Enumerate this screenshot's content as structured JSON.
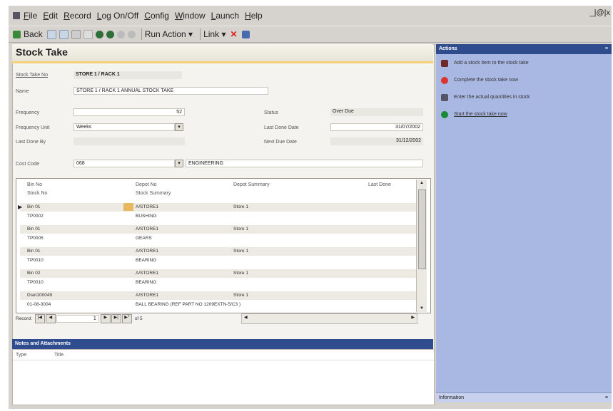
{
  "menu": [
    "File",
    "Edit",
    "Record",
    "Log On/Off",
    "Config",
    "Window",
    "Launch",
    "Help"
  ],
  "window_controls": "_|@|x",
  "toolbar": {
    "back": "Back",
    "run_action": "Run Action ▾",
    "link": "Link ▾"
  },
  "page_title": "Stock Take",
  "form": {
    "stock_take_no_label": "Stock Take No",
    "stock_take_no": "STORE 1 / RACK 1",
    "name_label": "Name",
    "name": "STORE 1 / RACK 1 ANNUAL STOCK TAKE",
    "frequency_label": "Frequency",
    "frequency": "52",
    "frequency_unit_label": "Frequency Unit",
    "frequency_unit": "Weeks",
    "last_done_by_label": "Last Done By",
    "last_done_by": "",
    "status_label": "Status",
    "status": "Over Due",
    "last_done_date_label": "Last Done Date",
    "last_done_date": "31/07/2002",
    "next_due_date_label": "Next Due Date",
    "next_due_date": "31/12/2002",
    "cost_code_label": "Cost Code",
    "cost_code": "068",
    "cost_code_desc": "ENGINEERING"
  },
  "grid": {
    "headers": {
      "bin_no": "Bin No",
      "stock_no": "Stock No",
      "depot_no": "Depot No",
      "stock_summary": "Stock Summary",
      "depot_summary": "Depot Summary",
      "last_done": "Last Done"
    },
    "rows": [
      {
        "bin": "Bin 01",
        "stock": "TP0002",
        "depot": "A/STORE1",
        "summary": "BUSHING",
        "depot_summary": "Store 1"
      },
      {
        "bin": "Bin 01",
        "stock": "TP0005",
        "depot": "A/STORE1",
        "summary": "GEARS",
        "depot_summary": "Store 1"
      },
      {
        "bin": "Bin 01",
        "stock": "TP0010",
        "depot": "A/STORE1",
        "summary": "BEARING",
        "depot_summary": "Store 1"
      },
      {
        "bin": "Bin 02",
        "stock": "TP0010",
        "depot": "A/STORE1",
        "summary": "BEARING",
        "depot_summary": "Store 1"
      },
      {
        "bin": "Dset100049",
        "stock": "01-08-3004",
        "depot": "A/STORE1",
        "summary": "BALL BEARING (REF PART NO 1209EXTN-5/C3 )",
        "depot_summary": "Store 1"
      }
    ],
    "record_label": "Record:",
    "record_value": "1",
    "of_label": "of 5"
  },
  "notes": {
    "title": "Notes and Attachments",
    "col_type": "Type",
    "col_title": "Title"
  },
  "actions": {
    "title": "Actions",
    "items": [
      "Add a stock item to the stock take",
      "Complete the stock take now",
      "Enter the actual quantities in stock",
      "Start the stock take now"
    ],
    "collapse": "≡"
  },
  "information": {
    "title": "Information",
    "collapse": "≡"
  }
}
